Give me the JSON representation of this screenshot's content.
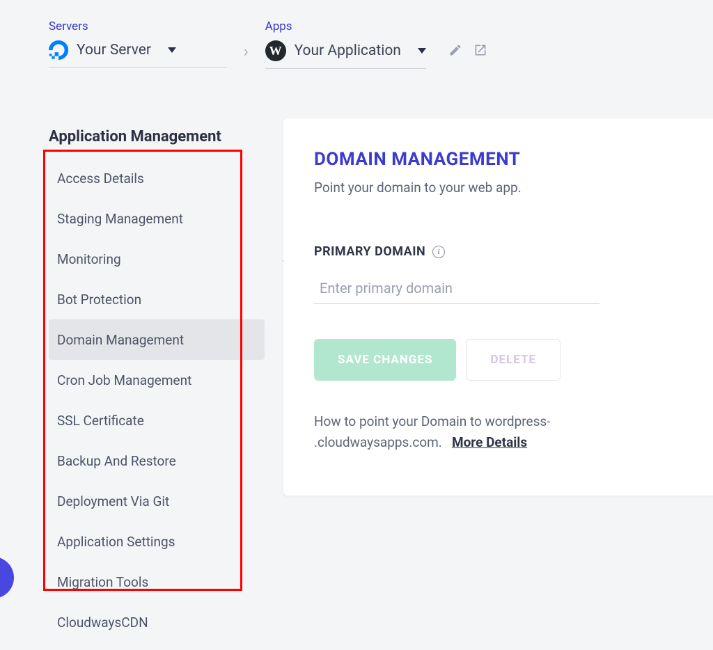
{
  "breadcrumb": {
    "servers_label": "Servers",
    "server_name": "Your Server",
    "apps_label": "Apps",
    "app_name": "Your Application"
  },
  "sidebar": {
    "title": "Application Management",
    "items": [
      {
        "label": "Access Details",
        "active": false,
        "expandable": false
      },
      {
        "label": "Staging Management",
        "active": false,
        "expandable": false
      },
      {
        "label": "Monitoring",
        "active": false,
        "expandable": true
      },
      {
        "label": "Bot Protection",
        "active": false,
        "expandable": false
      },
      {
        "label": "Domain Management",
        "active": true,
        "expandable": false
      },
      {
        "label": "Cron Job Management",
        "active": false,
        "expandable": false
      },
      {
        "label": "SSL Certificate",
        "active": false,
        "expandable": false
      },
      {
        "label": "Backup And Restore",
        "active": false,
        "expandable": false
      },
      {
        "label": "Deployment Via Git",
        "active": false,
        "expandable": false
      },
      {
        "label": "Application Settings",
        "active": false,
        "expandable": false
      },
      {
        "label": "Migration Tools",
        "active": false,
        "expandable": false
      },
      {
        "label": "CloudwaysCDN",
        "active": false,
        "expandable": false
      }
    ]
  },
  "main": {
    "title": "DOMAIN MANAGEMENT",
    "subtitle": "Point your domain to your web app.",
    "field_label": "PRIMARY DOMAIN",
    "placeholder": "Enter primary domain",
    "save_label": "SAVE CHANGES",
    "delete_label": "DELETE",
    "help_prefix": "How to point your Domain to wordpress-",
    "help_suffix": ".cloudwaysapps.com.",
    "more_details": "More Details"
  }
}
